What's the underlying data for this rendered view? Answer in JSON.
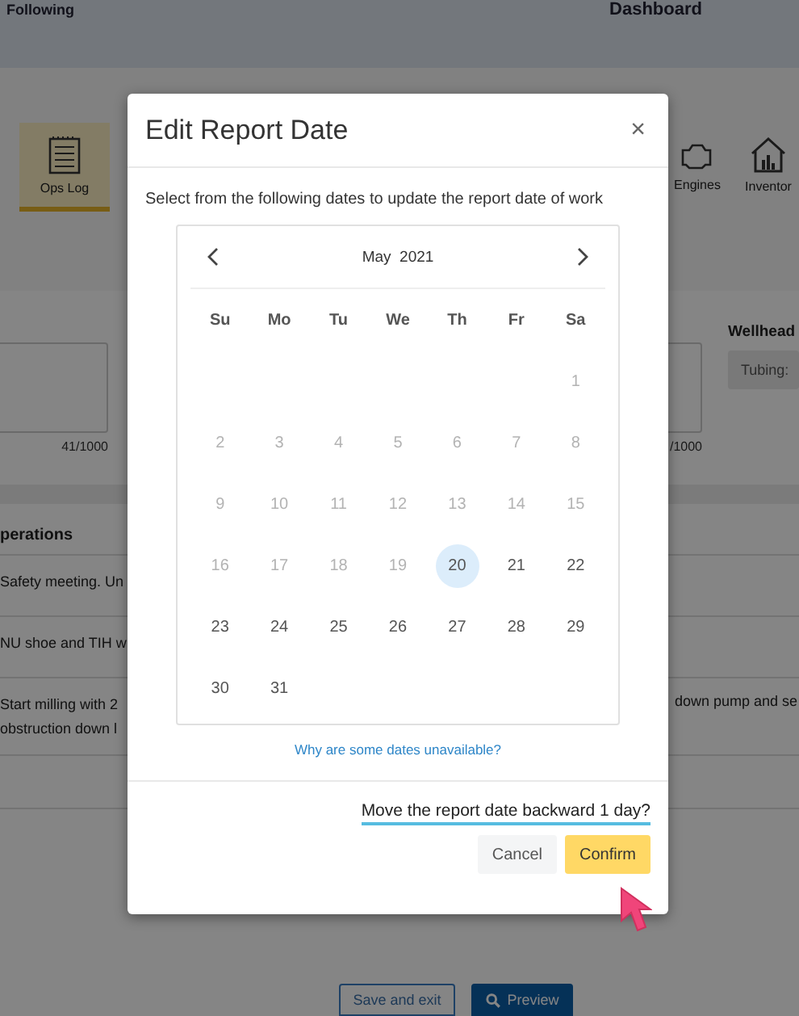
{
  "top_bar": {
    "left": "Following",
    "right": "Dashboard"
  },
  "tiles": [
    {
      "label": "Ops Log",
      "kind": "notebook",
      "selected": true
    },
    {
      "label": "Engines",
      "kind": "engine",
      "selected": false
    },
    {
      "label": "Inventor",
      "kind": "house",
      "selected": false
    }
  ],
  "form": {
    "left_counter": "41/1000",
    "right_counter": "/1000",
    "wellhead_label": "Wellhead",
    "tubing_label": "Tubing:"
  },
  "operations": {
    "title": "perations",
    "rows": [
      {
        "left": [
          "Safety meeting. Un"
        ]
      },
      {
        "left": [
          "NU shoe and TIH w"
        ]
      },
      {
        "left": [
          "Start milling with 2",
          "obstruction down l"
        ],
        "right": "down pump and se"
      }
    ]
  },
  "footer_buttons": [
    {
      "label": "Save and exit",
      "kind": "outline"
    },
    {
      "label": "Preview",
      "kind": "primary"
    }
  ],
  "dialog": {
    "title": "Edit Report Date",
    "close": "×",
    "description": "Select from the following dates to update the report date of work",
    "calendar": {
      "month": "May  2021",
      "weekdays": [
        "Su",
        "Mo",
        "Tu",
        "We",
        "Th",
        "Fr",
        "Sa"
      ],
      "weeks": [
        [
          {
            "label": "1",
            "disabled": true,
            "selected": false
          }
        ],
        [
          {
            "label": "2",
            "disabled": true,
            "selected": false
          },
          {
            "label": "3",
            "disabled": true,
            "selected": false
          },
          {
            "label": "4",
            "disabled": true,
            "selected": false
          },
          {
            "label": "5",
            "disabled": true,
            "selected": false
          },
          {
            "label": "6",
            "disabled": true,
            "selected": false
          },
          {
            "label": "7",
            "disabled": true,
            "selected": false
          },
          {
            "label": "8",
            "disabled": true,
            "selected": false
          }
        ],
        [
          {
            "label": "9",
            "disabled": true,
            "selected": false
          },
          {
            "label": "10",
            "disabled": true,
            "selected": false
          },
          {
            "label": "11",
            "disabled": true,
            "selected": false
          },
          {
            "label": "12",
            "disabled": true,
            "selected": false
          },
          {
            "label": "13",
            "disabled": true,
            "selected": false
          },
          {
            "label": "14",
            "disabled": true,
            "selected": false
          },
          {
            "label": "15",
            "disabled": true,
            "selected": false
          }
        ],
        [
          {
            "label": "16",
            "disabled": true,
            "selected": false
          },
          {
            "label": "17",
            "disabled": true,
            "selected": false
          },
          {
            "label": "18",
            "disabled": true,
            "selected": false
          },
          {
            "label": "19",
            "disabled": true,
            "selected": false
          },
          {
            "label": "20",
            "disabled": false,
            "selected": true
          },
          {
            "label": "21",
            "disabled": false,
            "selected": false
          },
          {
            "label": "22",
            "disabled": false,
            "selected": false
          }
        ],
        [
          {
            "label": "23",
            "disabled": false,
            "selected": false
          },
          {
            "label": "24",
            "disabled": false,
            "selected": false
          },
          {
            "label": "25",
            "disabled": false,
            "selected": false
          },
          {
            "label": "26",
            "disabled": false,
            "selected": false
          },
          {
            "label": "27",
            "disabled": false,
            "selected": false
          },
          {
            "label": "28",
            "disabled": false,
            "selected": false
          },
          {
            "label": "29",
            "disabled": false,
            "selected": false
          }
        ],
        [
          {
            "label": "30",
            "disabled": false,
            "selected": false
          },
          {
            "label": "31",
            "disabled": false,
            "selected": false
          }
        ]
      ]
    },
    "help_link": "Why are some dates unavailable?",
    "question": "Move the report date backward 1 day?",
    "buttons": [
      {
        "label": "Cancel",
        "kind": "secondary"
      },
      {
        "label": "Confirm",
        "kind": "primary"
      }
    ]
  }
}
